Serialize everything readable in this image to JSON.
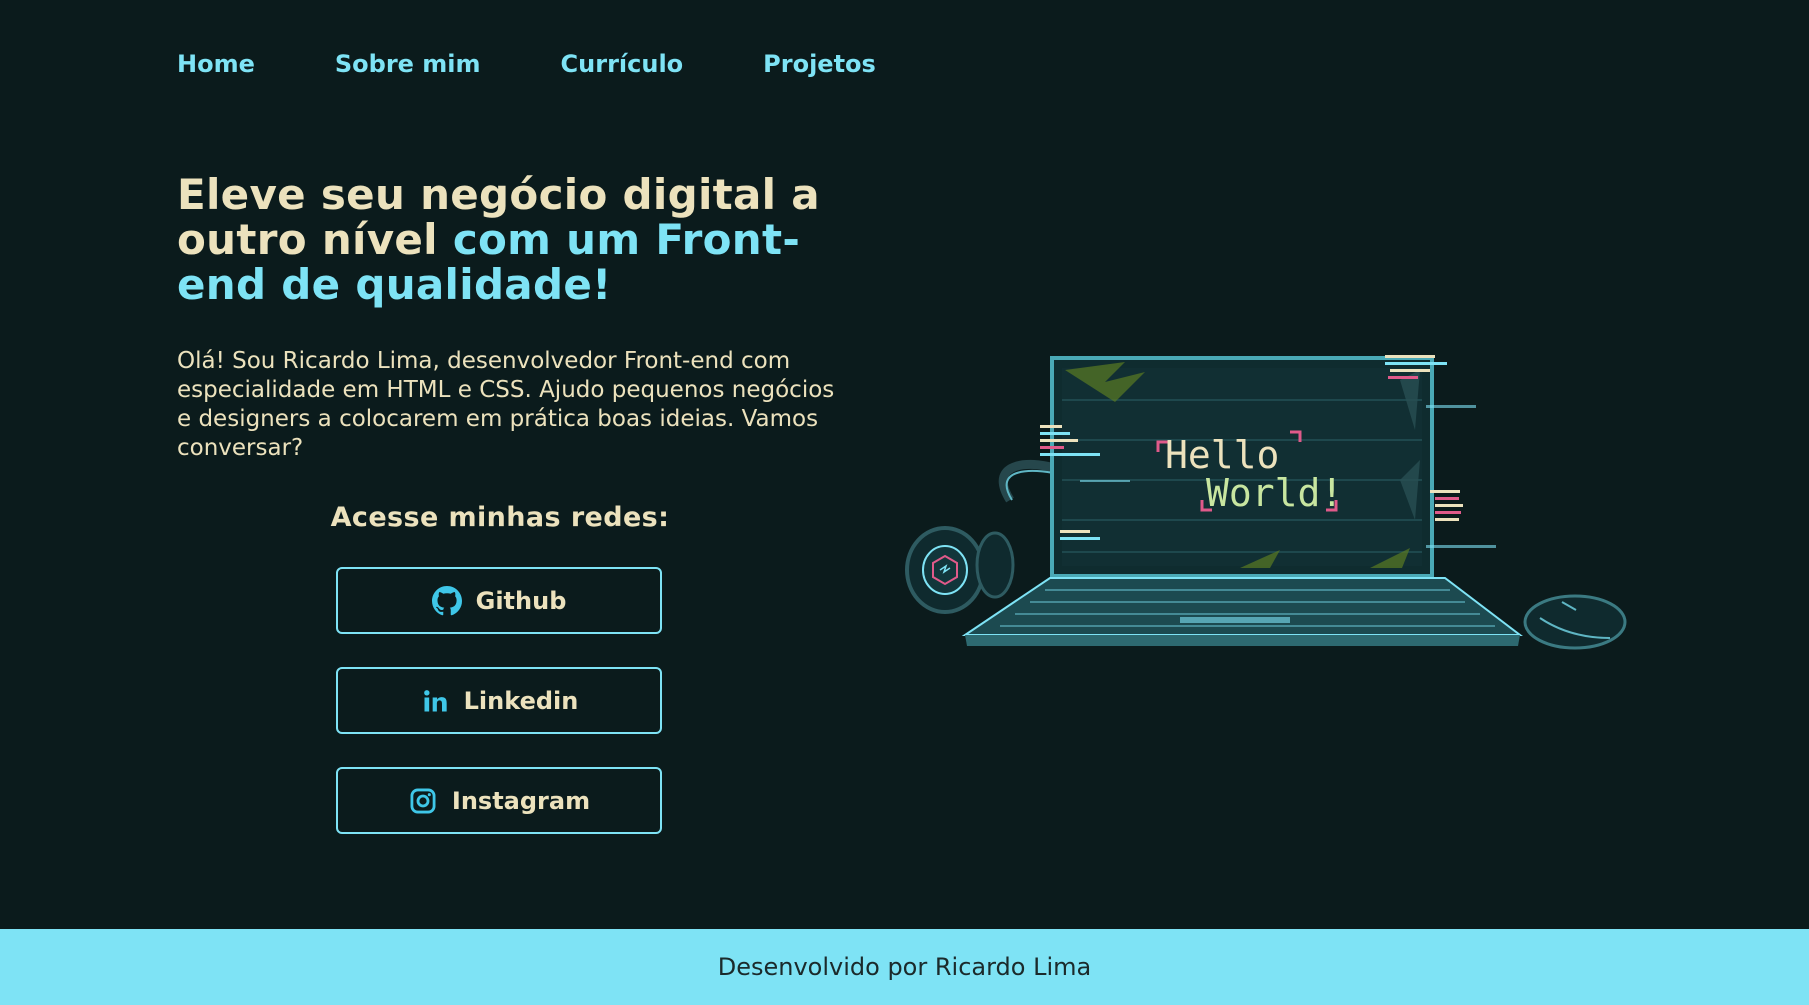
{
  "nav": {
    "items": [
      {
        "label": "Home"
      },
      {
        "label": "Sobre mim"
      },
      {
        "label": "Currículo"
      },
      {
        "label": "Projetos"
      }
    ]
  },
  "hero": {
    "title_part1": "Eleve seu negócio digital a outro nível ",
    "title_part2": "com um Front-end de qualidade!",
    "intro": "Olá! Sou Ricardo Lima, desenvolvedor Front-end com especialidade em HTML e CSS. Ajudo pequenos negócios e designers a colocarem em prática boas ideias. Vamos conversar?"
  },
  "social": {
    "title": "Acesse minhas redes:",
    "buttons": [
      {
        "label": "Github",
        "icon": "github-icon"
      },
      {
        "label": "Linkedin",
        "icon": "linkedin-icon"
      },
      {
        "label": "Instagram",
        "icon": "instagram-icon"
      }
    ]
  },
  "illustration": {
    "screen_text_line1": "Hello",
    "screen_text_line2": "World!"
  },
  "footer": {
    "text": "Desenvolvido por Ricardo Lima"
  },
  "colors": {
    "background": "#0b1b1c",
    "accent": "#7ee3f5",
    "text_cream": "#ece2bd"
  }
}
